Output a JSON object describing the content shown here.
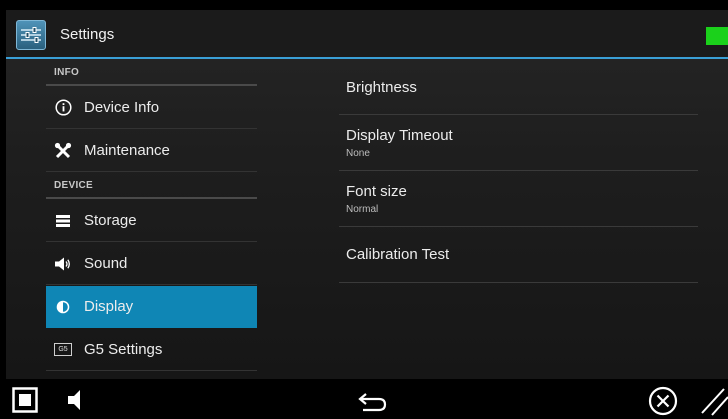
{
  "app": {
    "title": "Settings"
  },
  "colors": {
    "accent": "#3a9fd6",
    "selected": "#0f86b5",
    "status": "#1bd11b"
  },
  "sidebar": {
    "headers": [
      "INFO",
      "DEVICE"
    ],
    "items": [
      {
        "label": "Device Info",
        "icon": "info-icon"
      },
      {
        "label": "Maintenance",
        "icon": "tools-icon"
      },
      {
        "label": "Storage",
        "icon": "storage-icon"
      },
      {
        "label": "Sound",
        "icon": "speaker-icon"
      },
      {
        "label": "Display",
        "icon": "display-icon",
        "selected": true
      },
      {
        "label": "G5 Settings",
        "icon": "g5-icon",
        "icon_text": "G5"
      }
    ]
  },
  "display_settings": [
    {
      "title": "Brightness",
      "summary": ""
    },
    {
      "title": "Display Timeout",
      "summary": "None"
    },
    {
      "title": "Font size",
      "summary": "Normal"
    },
    {
      "title": "Calibration Test",
      "summary": ""
    }
  ],
  "navbar": {
    "buttons": [
      "stop-icon",
      "volume-icon",
      "back-icon",
      "close-icon",
      "resize-icon"
    ]
  }
}
